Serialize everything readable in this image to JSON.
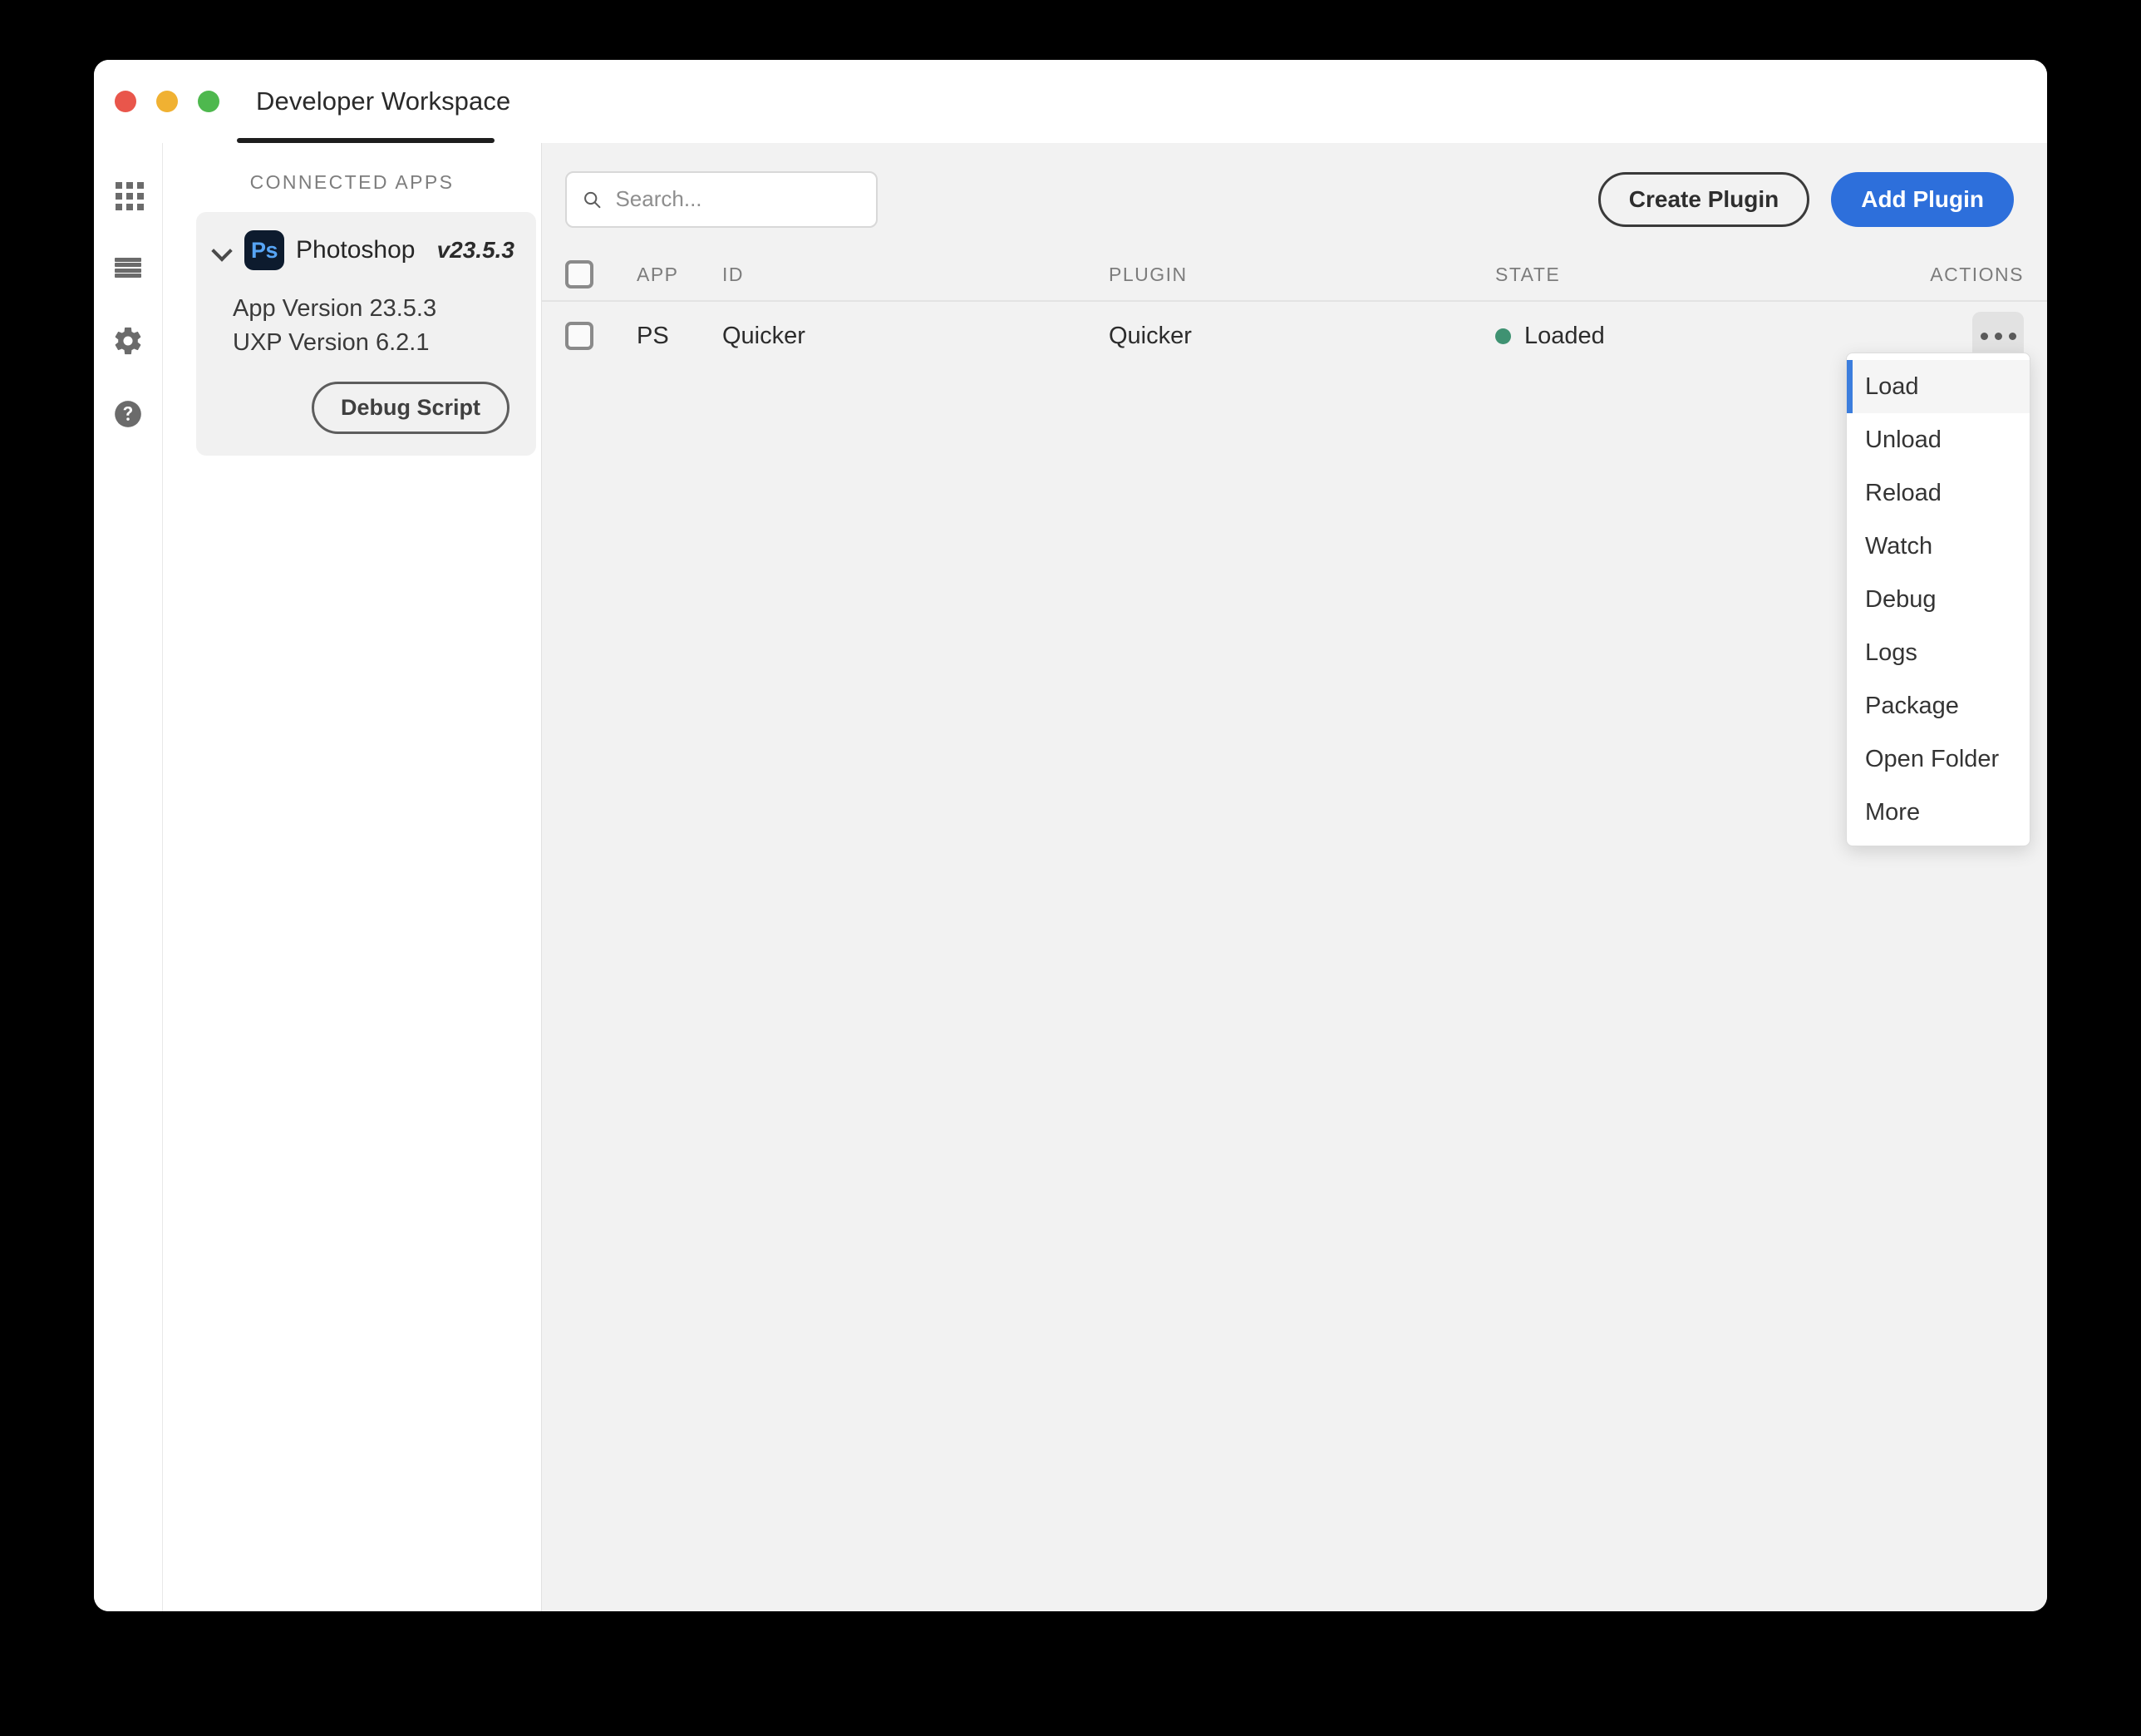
{
  "window": {
    "title": "Developer Workspace",
    "traffic_lights": [
      "close",
      "minimize",
      "zoom"
    ],
    "colors": {
      "close": "#e9564b",
      "minimize": "#f0b132",
      "zoom": "#4eb84e",
      "accent_primary": "#2d6fdb",
      "menu_accent": "#3b7ddd",
      "state_loaded": "#3f9272",
      "ps_icon_bg": "#0d1b2e",
      "ps_icon_fg": "#57a5f5"
    }
  },
  "rail": {
    "items": [
      {
        "icon": "grid-icon",
        "name": "apps"
      },
      {
        "icon": "list-icon",
        "name": "list"
      },
      {
        "icon": "gear-icon",
        "name": "settings"
      },
      {
        "icon": "help-icon",
        "name": "help"
      }
    ]
  },
  "sidebar": {
    "heading": "CONNECTED APPS",
    "app": {
      "name": "Photoshop",
      "version_tag": "v23.5.3",
      "icon_label": "Ps",
      "app_version": "App Version 23.5.3",
      "uxp_version": "UXP Version 6.2.1",
      "debug_button": "Debug Script"
    }
  },
  "toolbar": {
    "search_placeholder": "Search...",
    "search_value": "",
    "create_plugin_label": "Create Plugin",
    "add_plugin_label": "Add Plugin"
  },
  "table": {
    "headers": {
      "app": "APP",
      "id": "ID",
      "plugin": "PLUGIN",
      "state": "STATE",
      "actions": "ACTIONS"
    },
    "rows": [
      {
        "app": "PS",
        "id": "Quicker",
        "plugin": "Quicker",
        "state": "Loaded",
        "selected": false
      }
    ]
  },
  "context_menu": {
    "items": [
      {
        "label": "Load",
        "active": true
      },
      {
        "label": "Unload",
        "active": false
      },
      {
        "label": "Reload",
        "active": false
      },
      {
        "label": "Watch",
        "active": false
      },
      {
        "label": "Debug",
        "active": false
      },
      {
        "label": "Logs",
        "active": false
      },
      {
        "label": "Package",
        "active": false
      },
      {
        "label": "Open Folder",
        "active": false
      },
      {
        "label": "More",
        "active": false
      }
    ]
  }
}
